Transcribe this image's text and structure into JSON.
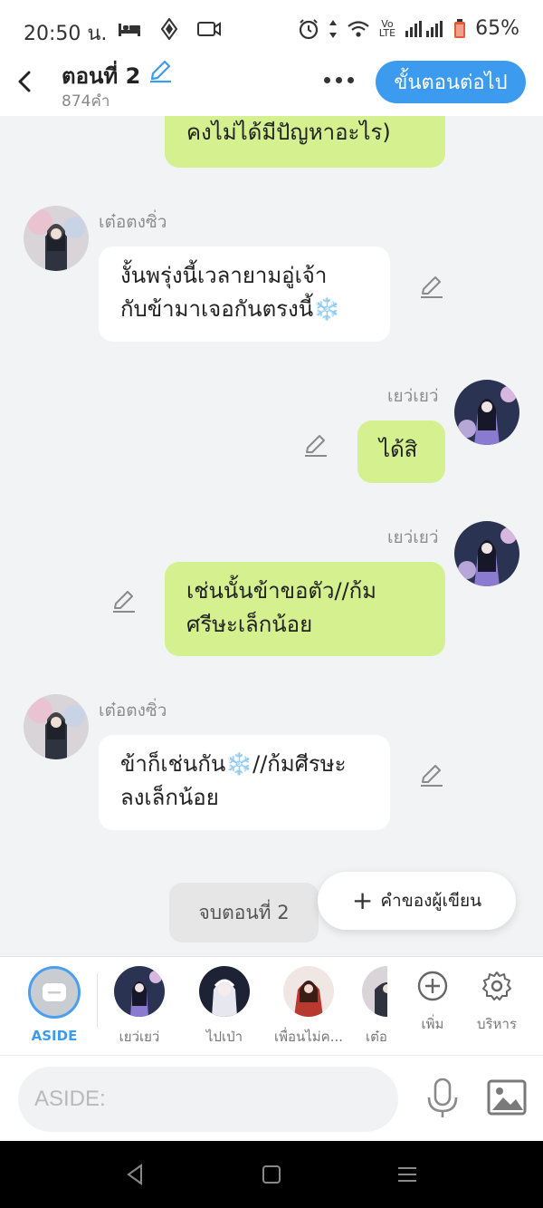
{
  "status_bar": {
    "time": "20:50 น.",
    "lte_top": "Vo",
    "lte_bottom": "LTE",
    "battery": "65%"
  },
  "header": {
    "title": "ตอนที่ 2",
    "word_count": "874คำ",
    "next_button": "ขั้นตอนต่อไป"
  },
  "messages": [
    {
      "side": "right",
      "text": "คงไม่ได้มีปัญหาอะไร)"
    },
    {
      "side": "left",
      "name": "เต๋อตงซิ่ว",
      "line1": "งั้นพรุ่งนี้เวลายามอู่เจ้า",
      "line2": "กับข้ามาเจอกันตรงนี้❄️"
    },
    {
      "side": "right",
      "name": "เยว่เยว่",
      "text": "ได้สิ"
    },
    {
      "side": "right",
      "name": "เยว่เยว่",
      "line1": "เช่นนั้นข้าขอตัว//ก้ม",
      "line2": "ศรีษะเล็กน้อย"
    },
    {
      "side": "left",
      "name": "เต๋อตงซิ่ว",
      "line1": "ข้าก็เช่นกัน❄️//ก้มศีรษะ",
      "line2": "ลงเล็กน้อย"
    }
  ],
  "end_chip": "จบตอนที่ 2",
  "author_note": "คำของผู้เขียน",
  "characters": {
    "aside": "ASIDE",
    "c1": "เยว่เยว่",
    "c2": "ไปเป่า",
    "c3": "เพื่อนไม่ค...",
    "c4": "เต๋อ",
    "add": "เพิ่ม",
    "manage": "บริหาร"
  },
  "input": {
    "placeholder": "ASIDE:"
  },
  "colors": {
    "accent": "#3d9bef",
    "bubble_right": "#d4f08f",
    "bubble_left": "#ffffff",
    "background": "#f2f3f5"
  }
}
